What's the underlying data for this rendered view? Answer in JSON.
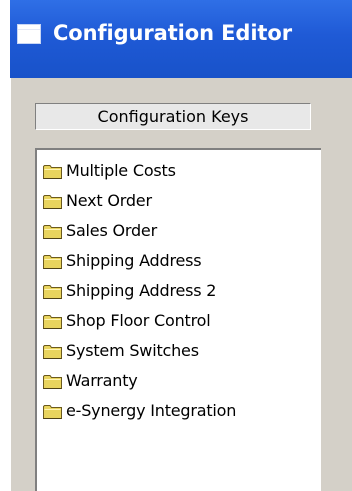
{
  "window": {
    "title": "Configuration Editor"
  },
  "header": {
    "label": "Configuration Keys"
  },
  "list": {
    "items": [
      {
        "label": "Multiple Costs",
        "icon": "folder-icon"
      },
      {
        "label": "Next Order",
        "icon": "folder-icon"
      },
      {
        "label": "Sales Order",
        "icon": "folder-icon"
      },
      {
        "label": "Shipping Address",
        "icon": "folder-icon"
      },
      {
        "label": "Shipping Address 2",
        "icon": "folder-icon"
      },
      {
        "label": "Shop Floor Control",
        "icon": "folder-icon"
      },
      {
        "label": "System Switches",
        "icon": "folder-icon"
      },
      {
        "label": "Warranty",
        "icon": "folder-icon"
      },
      {
        "label": "e-Synergy Integration",
        "icon": "folder-icon"
      }
    ]
  },
  "colors": {
    "titlebar": "#1f5ad6",
    "window_bg": "#d4d0c8",
    "folder": "#e8d25a"
  }
}
